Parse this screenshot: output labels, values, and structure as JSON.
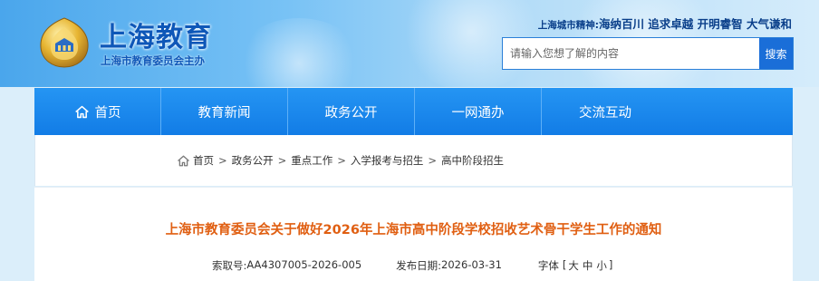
{
  "header": {
    "logo_title": "上海教育",
    "logo_subtitle": "上海市教育委员会主办",
    "spirit_label": "上海城市精神:",
    "spirit_text": "海纳百川 追求卓越 开明睿智 大气谦和",
    "emblem_icon": "shanghai-education-emblem",
    "colors": {
      "brand_blue": "#0e57b8",
      "nav_blue": "#1a86ec",
      "title_orange": "#e05f12"
    }
  },
  "search": {
    "placeholder": "请输入您想了解的内容",
    "button_label": "搜索"
  },
  "nav": {
    "items": [
      {
        "label": "首页",
        "icon": "home-icon"
      },
      {
        "label": "教育新闻"
      },
      {
        "label": "政务公开"
      },
      {
        "label": "一网通办"
      },
      {
        "label": "交流互动"
      }
    ]
  },
  "breadcrumb": {
    "icon": "home-icon",
    "items": [
      "首页",
      "政务公开",
      "重点工作",
      "入学报考与招生",
      "高中阶段招生"
    ],
    "separator": ">"
  },
  "article": {
    "title": "上海市教育委员会关于做好2026年上海市高中阶段学校招收艺术骨干学生工作的通知",
    "index_label": "索取号:",
    "index_value": "AA4307005-2026-005",
    "date_label": "发布日期:",
    "date_value": "2026-03-31",
    "font_label": "字体",
    "font_open": "[",
    "font_large": "大",
    "font_medium": "中",
    "font_small": "小",
    "font_close": "]"
  }
}
